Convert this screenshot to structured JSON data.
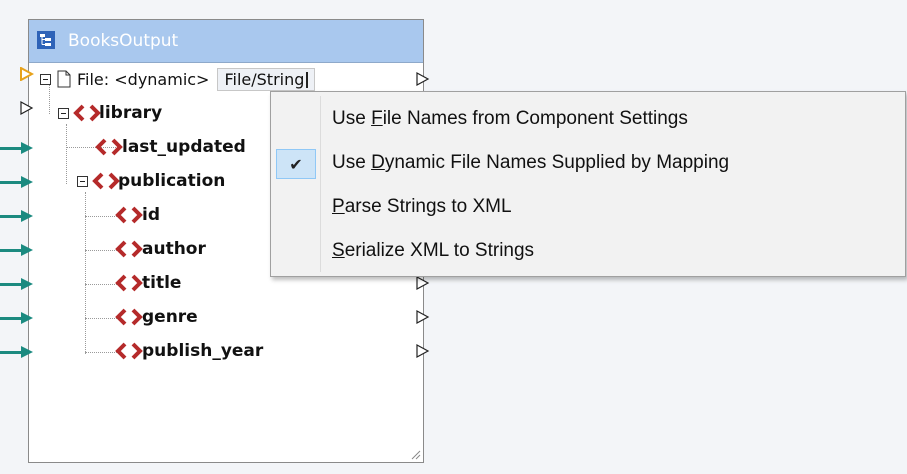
{
  "component": {
    "title": "BooksOutput",
    "file_label": "File: <dynamic>",
    "file_button": "File/String",
    "tree": [
      {
        "label": "library",
        "level": 1
      },
      {
        "label": "last_updated",
        "level": 2
      },
      {
        "label": "publication",
        "level": 2
      },
      {
        "label": "id",
        "level": 3
      },
      {
        "label": "author",
        "level": 3
      },
      {
        "label": "title",
        "level": 3
      },
      {
        "label": "genre",
        "level": 3
      },
      {
        "label": "publish_year",
        "level": 3
      }
    ]
  },
  "menu": {
    "items": [
      {
        "pre": "Use ",
        "accel": "F",
        "post": "ile Names from Component Settings",
        "checked": false
      },
      {
        "pre": "Use ",
        "accel": "D",
        "post": "ynamic File Names Supplied by Mapping",
        "checked": true
      },
      {
        "pre": "",
        "accel": "P",
        "post": "arse Strings to XML",
        "checked": false
      },
      {
        "pre": "",
        "accel": "S",
        "post": "erialize XML to Strings",
        "checked": false
      }
    ]
  },
  "colors": {
    "header": "#a9c8ee",
    "element_icon": "#b52a2a",
    "connector": "#1b8a80",
    "input_port_file": "#e7a21b",
    "checked_bg": "#cde4f7"
  }
}
